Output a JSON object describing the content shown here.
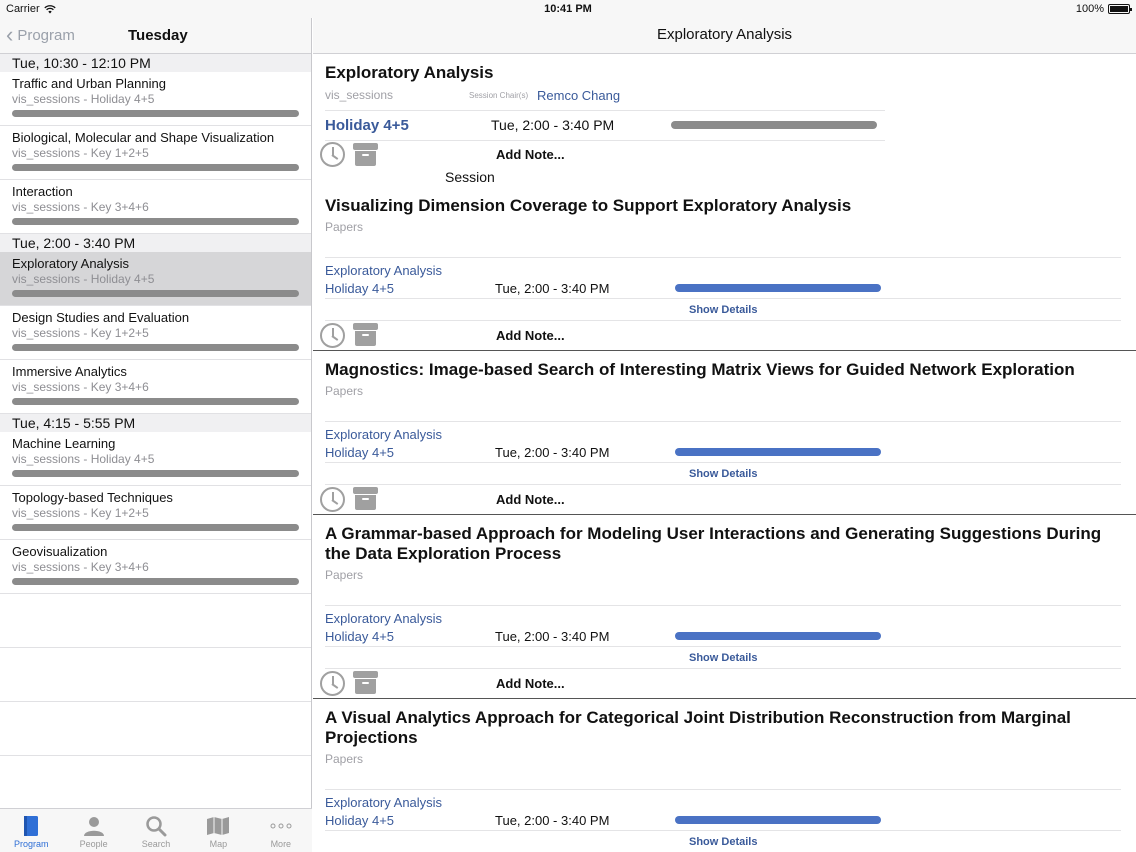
{
  "status": {
    "carrier": "Carrier",
    "time": "10:41 PM",
    "battery": "100%"
  },
  "left": {
    "back_label": "Program",
    "title": "Tuesday",
    "sections": [
      {
        "header": "Tue, 10:30 - 12:10 PM",
        "items": [
          {
            "title": "Traffic and Urban Planning",
            "subtitle": "vis_sessions - Holiday 4+5"
          },
          {
            "title": "Biological, Molecular and Shape Visualization",
            "subtitle": "vis_sessions - Key 1+2+5"
          },
          {
            "title": "Interaction",
            "subtitle": "vis_sessions - Key 3+4+6"
          }
        ]
      },
      {
        "header": "Tue, 2:00 - 3:40 PM",
        "items": [
          {
            "title": "Exploratory Analysis",
            "subtitle": "vis_sessions - Holiday 4+5"
          },
          {
            "title": "Design Studies and Evaluation",
            "subtitle": "vis_sessions - Key 1+2+5"
          },
          {
            "title": "Immersive Analytics",
            "subtitle": "vis_sessions - Key 3+4+6"
          }
        ]
      },
      {
        "header": "Tue, 4:15 - 5:55 PM",
        "items": [
          {
            "title": "Machine Learning",
            "subtitle": "vis_sessions - Holiday 4+5"
          },
          {
            "title": "Topology-based Techniques",
            "subtitle": "vis_sessions - Key 1+2+5"
          },
          {
            "title": "Geovisualization",
            "subtitle": "vis_sessions - Key 3+4+6"
          }
        ]
      }
    ]
  },
  "tabs": [
    {
      "label": "Program",
      "icon": "book-icon"
    },
    {
      "label": "People",
      "icon": "person-icon"
    },
    {
      "label": "Search",
      "icon": "search-icon"
    },
    {
      "label": "Map",
      "icon": "map-icon"
    },
    {
      "label": "More",
      "icon": "more-icon"
    }
  ],
  "right": {
    "nav_title": "Exploratory Analysis",
    "header": {
      "title": "Exploratory Analysis",
      "kind": "vis_sessions",
      "chair_label": "Session Chair(s)",
      "chair": "Remco Chang",
      "room": "Holiday 4+5",
      "time": "Tue, 2:00 - 3:40 PM",
      "add_note": "Add Note..."
    },
    "section_label": "Session",
    "papers": [
      {
        "title": "Visualizing Dimension Coverage to Support Exploratory Analysis",
        "type": "Papers",
        "session": "Exploratory Analysis",
        "room": "Holiday 4+5",
        "time": "Tue, 2:00 - 3:40 PM",
        "details": "Show Details",
        "add_note": "Add Note..."
      },
      {
        "title": "Magnostics: Image-based Search of Interesting Matrix Views for Guided Network Exploration",
        "type": "Papers",
        "session": "Exploratory Analysis",
        "room": "Holiday 4+5",
        "time": "Tue, 2:00 - 3:40 PM",
        "details": "Show Details",
        "add_note": "Add Note..."
      },
      {
        "title": "A Grammar-based Approach for Modeling User Interactions and Generating Suggestions During the Data Exploration Process",
        "type": "Papers",
        "session": "Exploratory Analysis",
        "room": "Holiday 4+5",
        "time": "Tue, 2:00 - 3:40 PM",
        "details": "Show Details",
        "add_note": "Add Note..."
      },
      {
        "title": "A Visual Analytics Approach for Categorical Joint Distribution Reconstruction from Marginal Projections",
        "type": "Papers",
        "session": "Exploratory Analysis",
        "room": "Holiday 4+5",
        "time": "Tue, 2:00 - 3:40 PM",
        "details": "Show Details",
        "add_note": ""
      }
    ]
  }
}
